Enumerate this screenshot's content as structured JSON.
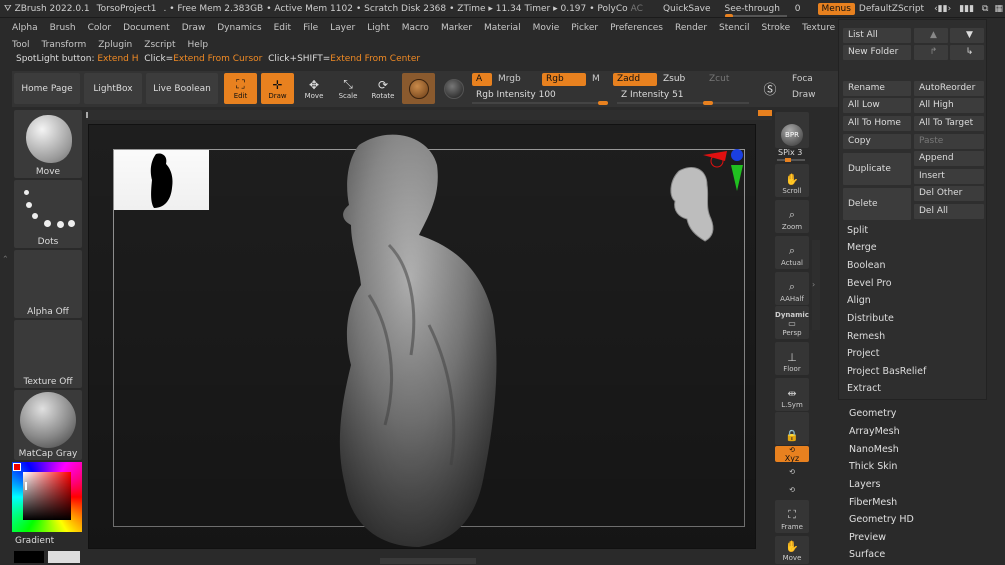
{
  "titlebar": {
    "app": "ZBrush 2022.0.1",
    "project": "TorsoProject1",
    "free_mem": ". • Free Mem 2.383GB",
    "active_mem": "• Active Mem 1102",
    "scratch": "• Scratch Disk 2368",
    "ztime": "• ZTime ▸ 11.34",
    "timer": "Timer ▸ 0.197",
    "polyco": "• PolyCo",
    "ac": "AC",
    "quicksave": "QuickSave",
    "seethrough_label": "See-through",
    "seethrough_value": "0",
    "menus": "Menus",
    "script": "DefaultZScript"
  },
  "menu1": [
    "Alpha",
    "Brush",
    "Color",
    "Document",
    "Draw",
    "Dynamics",
    "Edit",
    "File",
    "Layer",
    "Light",
    "Macro",
    "Marker",
    "Material",
    "Movie",
    "Picker",
    "Preferences",
    "Render",
    "Stencil",
    "Stroke",
    "Texture"
  ],
  "menu2": [
    "Tool",
    "Transform",
    "Zplugin",
    "Zscript",
    "Help"
  ],
  "hint": {
    "a": "SpotLight button:",
    "b": "Extend H",
    "c": "Click=",
    "d": "Extend From Cursor",
    "e": "Click+SHIFT=",
    "f": "Extend From Center"
  },
  "toolbar": {
    "home": "Home Page",
    "lightbox": "LightBox",
    "liveboolean": "Live Boolean",
    "edit": "Edit",
    "draw": "Draw",
    "move": "Move",
    "scale": "Scale",
    "rotate": "Rotate",
    "a": "A",
    "mrgb": "Mrgb",
    "rgb": "Rgb",
    "m": "M",
    "zadd": "Zadd",
    "zsub": "Zsub",
    "zcut": "Zcut",
    "rgb_intensity_label": "Rgb Intensity",
    "rgb_intensity": "100",
    "z_intensity_label": "Z Intensity",
    "z_intensity": "51",
    "focal": "Foca",
    "draw2": "Draw"
  },
  "left": {
    "brush": "Move",
    "stroke": "Dots",
    "alpha": "Alpha Off",
    "texture": "Texture Off",
    "material": "MatCap Gray",
    "gradient": "Gradient"
  },
  "right": {
    "bpr": "BPR",
    "spix": "SPix 3",
    "items": [
      "Scroll",
      "Zoom",
      "Actual",
      "AAHalf",
      "Persp",
      "Floor",
      "L.Sym",
      "",
      "Xyz",
      "",
      "",
      "Frame",
      "Move"
    ],
    "dynamic": "Dynamic"
  },
  "panel": {
    "listall": "List All",
    "newfolder": "New Folder",
    "rename": "Rename",
    "autoreorder": "AutoReorder",
    "alllow": "All Low",
    "allhigh": "All High",
    "alltohome": "All To Home",
    "alltotarget": "All To Target",
    "copy": "Copy",
    "paste": "Paste",
    "duplicate": "Duplicate",
    "append": "Append",
    "insert": "Insert",
    "delete": "Delete",
    "delother": "Del Other",
    "delall": "Del All",
    "items": [
      "Split",
      "Merge",
      "Boolean",
      "Bevel Pro",
      "Align",
      "Distribute",
      "Remesh",
      "Project",
      "Project BasRelief",
      "Extract"
    ]
  },
  "subpalettes": [
    "Geometry",
    "ArrayMesh",
    "NanoMesh",
    "Thick Skin",
    "Layers",
    "FiberMesh",
    "Geometry HD",
    "Preview",
    "Surface"
  ],
  "colors": {
    "accent": "#e8811f",
    "viewport": "#1e1e1e",
    "panel": "#2e2e2e"
  }
}
